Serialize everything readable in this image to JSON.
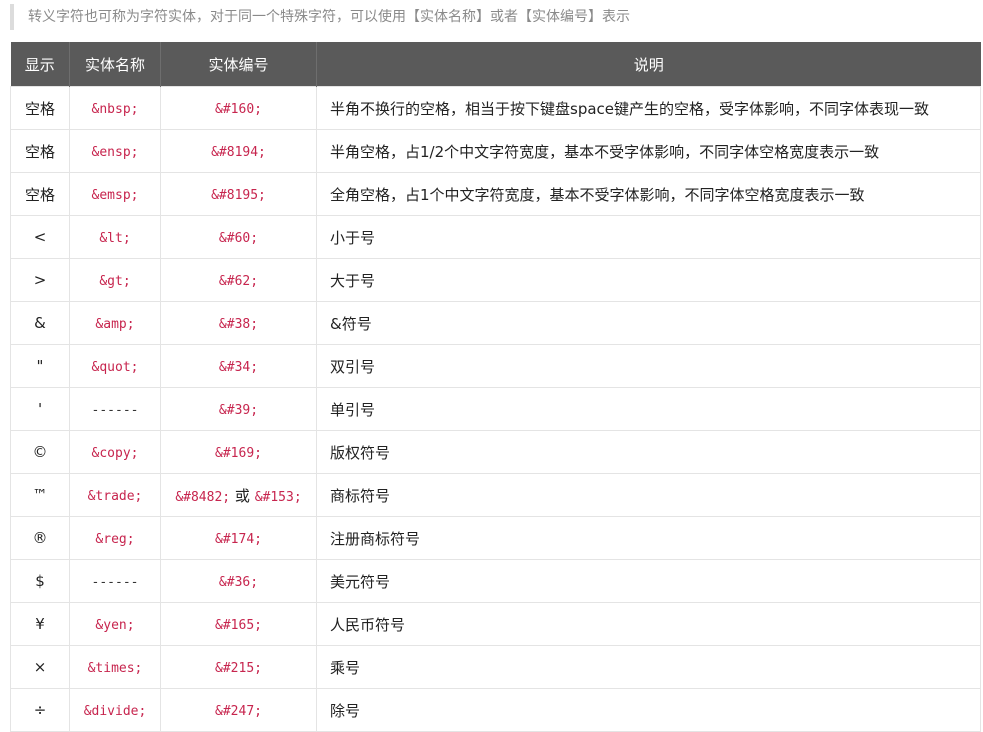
{
  "intro": "转义字符也可称为字符实体，对于同一个特殊字符，可以使用【实体名称】或者【实体编号】表示",
  "headers": [
    "显示",
    "实体名称",
    "实体编号",
    "说明"
  ],
  "rows": [
    {
      "display": "空格",
      "name": "&nbsp;",
      "number": "&#160;",
      "desc": "半角不换行的空格，相当于按下键盘space键产生的空格，受字体影响，不同字体表现一致"
    },
    {
      "display": "空格",
      "name": "&ensp;",
      "number": "&#8194;",
      "desc": "半角空格，占1/2个中文字符宽度，基本不受字体影响，不同字体空格宽度表示一致"
    },
    {
      "display": "空格",
      "name": "&emsp;",
      "number": "&#8195;",
      "desc": "全角空格，占1个中文字符宽度，基本不受字体影响，不同字体空格宽度表示一致"
    },
    {
      "display": "<",
      "name": "&lt;",
      "number": "&#60;",
      "desc": "小于号"
    },
    {
      "display": ">",
      "name": "&gt;",
      "number": "&#62;",
      "desc": "大于号"
    },
    {
      "display": "&",
      "name": "&amp;",
      "number": "&#38;",
      "desc": "&符号"
    },
    {
      "display": "\"",
      "name": "&quot;",
      "number": "&#34;",
      "desc": "双引号"
    },
    {
      "display": "'",
      "name": "------",
      "number": "&#39;",
      "desc": "单引号"
    },
    {
      "display": "©",
      "name": "&copy;",
      "number": "&#169;",
      "desc": "版权符号"
    },
    {
      "display": "™",
      "name": "&trade;",
      "number": "&#8482;",
      "number_or": "或",
      "number2": "&#153;",
      "desc": "商标符号"
    },
    {
      "display": "®",
      "name": "&reg;",
      "number": "&#174;",
      "desc": "注册商标符号"
    },
    {
      "display": "$",
      "name": "------",
      "number": "&#36;",
      "desc": "美元符号"
    },
    {
      "display": "¥",
      "name": "&yen;",
      "number": "&#165;",
      "desc": "人民币符号"
    },
    {
      "display": "×",
      "name": "&times;",
      "number": "&#215;",
      "desc": "乘号"
    },
    {
      "display": "÷",
      "name": "&divide;",
      "number": "&#247;",
      "desc": "除号"
    }
  ]
}
